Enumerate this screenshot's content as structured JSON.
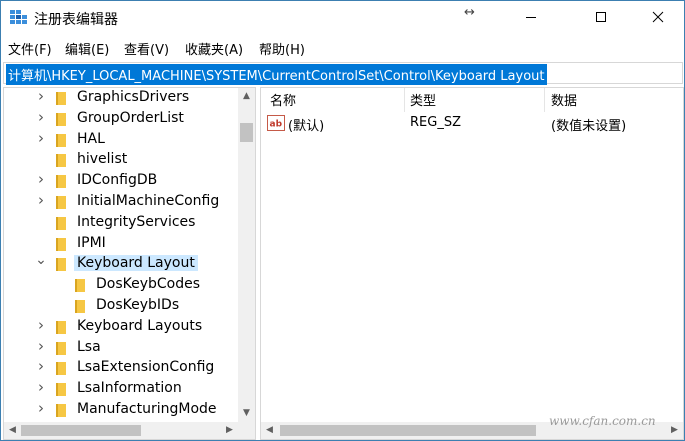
{
  "window": {
    "title": "注册表编辑器",
    "resize_glyph": "↔"
  },
  "menu": [
    "文件(F)",
    "编辑(E)",
    "查看(V)",
    "收藏夹(A)",
    "帮助(H)"
  ],
  "address": {
    "path": "计算机\\HKEY_LOCAL_MACHINE\\SYSTEM\\CurrentControlSet\\Control\\Keyboard Layout"
  },
  "tree": {
    "items": [
      {
        "label": "GraphicsDrivers",
        "expander": "collapsed",
        "depth": 0
      },
      {
        "label": "GroupOrderList",
        "expander": "collapsed",
        "depth": 0
      },
      {
        "label": "HAL",
        "expander": "collapsed",
        "depth": 0
      },
      {
        "label": "hivelist",
        "expander": "none",
        "depth": 0
      },
      {
        "label": "IDConfigDB",
        "expander": "collapsed",
        "depth": 0
      },
      {
        "label": "InitialMachineConfig",
        "expander": "collapsed",
        "depth": 0
      },
      {
        "label": "IntegrityServices",
        "expander": "none",
        "depth": 0
      },
      {
        "label": "IPMI",
        "expander": "none",
        "depth": 0
      },
      {
        "label": "Keyboard Layout",
        "expander": "expanded",
        "depth": 0,
        "selected": true
      },
      {
        "label": "DosKeybCodes",
        "expander": "none",
        "depth": 1
      },
      {
        "label": "DosKeybIDs",
        "expander": "none",
        "depth": 1
      },
      {
        "label": "Keyboard Layouts",
        "expander": "collapsed",
        "depth": 0
      },
      {
        "label": "Lsa",
        "expander": "collapsed",
        "depth": 0
      },
      {
        "label": "LsaExtensionConfig",
        "expander": "collapsed",
        "depth": 0
      },
      {
        "label": "LsaInformation",
        "expander": "collapsed",
        "depth": 0
      },
      {
        "label": "ManufacturingMode",
        "expander": "collapsed",
        "depth": 0
      }
    ]
  },
  "list": {
    "columns": [
      "名称",
      "类型",
      "数据"
    ],
    "rows": [
      {
        "name": "(默认)",
        "type": "REG_SZ",
        "data": "(数值未设置)",
        "icon": "string-value-icon",
        "icon_text": "ab"
      }
    ]
  },
  "watermark": "www.cfan.com.cn",
  "colors": {
    "selection_blue": "#0078d7",
    "tree_selected": "#cce8ff",
    "folder_yellow": "#f6c744"
  }
}
